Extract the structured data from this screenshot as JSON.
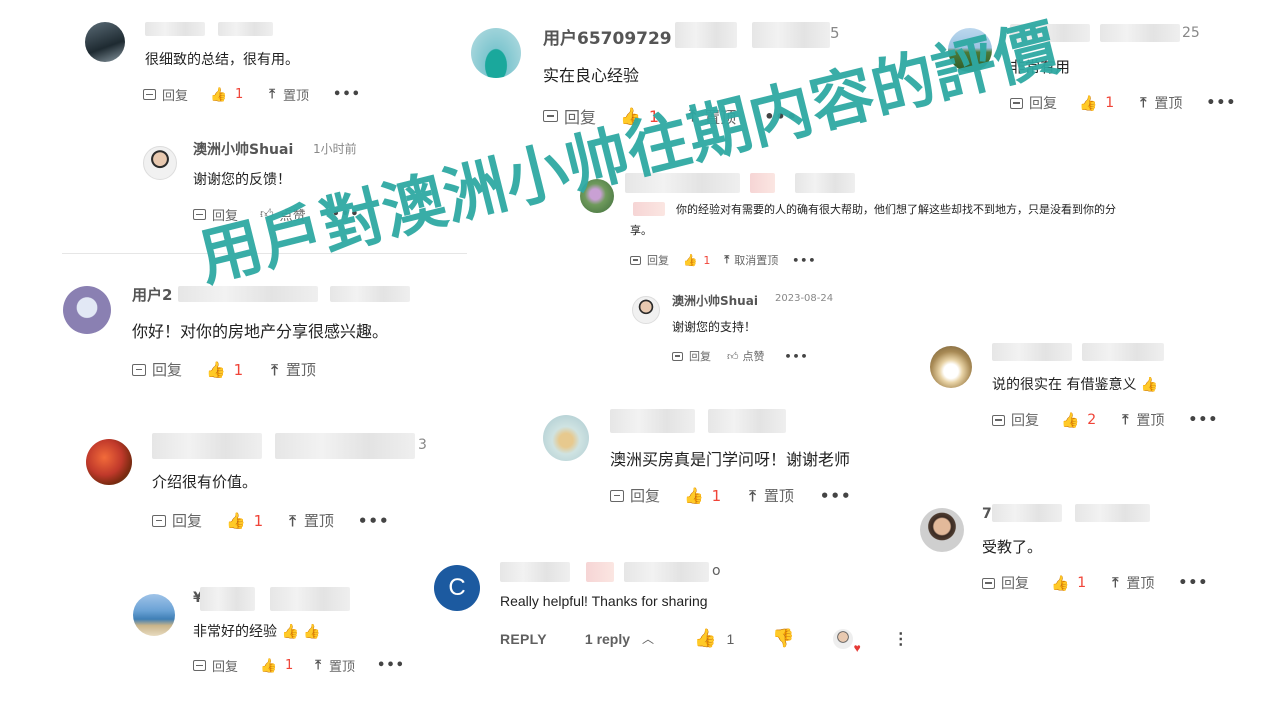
{
  "watermark": "用戶對澳洲小帅往期内容的評價",
  "actions": {
    "reply": "回复",
    "pin": "置顶",
    "unpin": "取消置顶",
    "like": "点赞",
    "more": "•••"
  },
  "comments": {
    "c1": {
      "text": "很细致的总结，很有用。",
      "likes": "1"
    },
    "c1_reply": {
      "author": "澳洲小帅Shuai",
      "time": "1小时前",
      "text": "谢谢您的反馈！"
    },
    "c2": {
      "author_prefix": "用户2",
      "text": "你好！对你的房地产分享很感兴趣。",
      "likes": "1"
    },
    "c3": {
      "author_suffix": "3",
      "text": "介绍很有价值。",
      "likes": "1"
    },
    "c4": {
      "author_prefix": "¥",
      "text": "非常好的经验",
      "likes": "1"
    },
    "c5": {
      "author_prefix": "用户65709729",
      "author_suffix": "5",
      "text": "实在良心经验",
      "likes": "1"
    },
    "c6": {
      "text_line1": "你的经验对有需要的人的确有很大帮助，他们想了解这些却找不到地方，只是没看到你的分",
      "text_line2": "享。",
      "likes": "1"
    },
    "c6_reply": {
      "author": "澳洲小帅Shuai",
      "time": "2023-08-24",
      "text": "谢谢您的支持！"
    },
    "c7": {
      "text": "澳洲买房真是门学问呀！谢谢老师",
      "likes": "1"
    },
    "c8": {
      "author_suffix": "25",
      "text": "非常有用",
      "likes": "1"
    },
    "c9": {
      "text": "说的很实在 有借鉴意义",
      "likes": "2"
    },
    "c10": {
      "author_prefix": "7",
      "text": "受教了。",
      "likes": "1"
    }
  },
  "youtube": {
    "avatar_letter": "C",
    "author_suffix": "o",
    "text": "Really helpful! Thanks for sharing",
    "reply_label": "REPLY",
    "replies": "1 reply",
    "likes": "1"
  },
  "colors": {
    "watermark": "#2fa9a3",
    "like_red": "#f04438",
    "yt_blue": "#1565c0"
  }
}
